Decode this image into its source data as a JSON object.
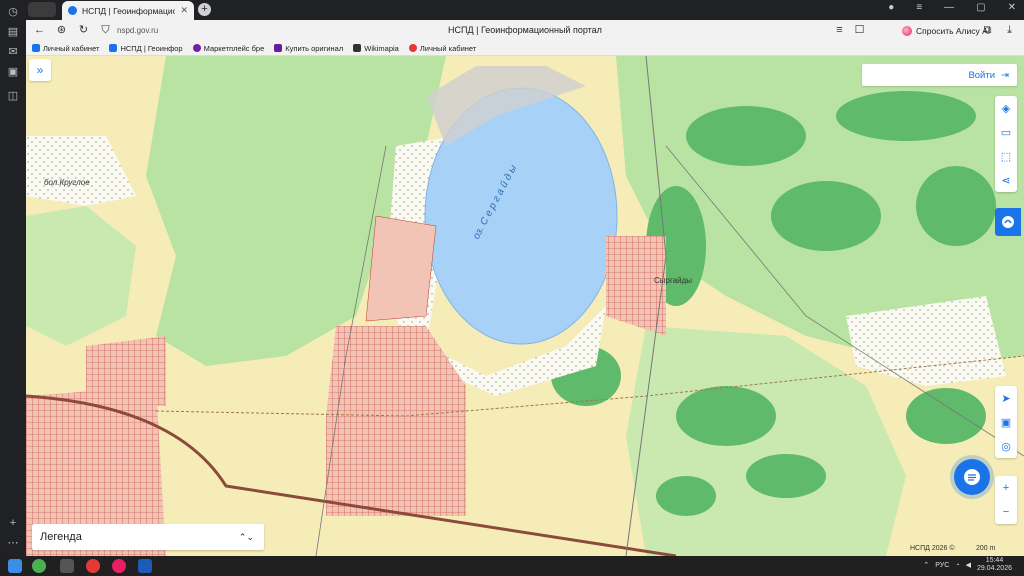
{
  "browser": {
    "tab_title": "НСПД | Геоинформационн",
    "url": "nspd.gov.ru",
    "page_title": "НСПД | Геоинформационный портал",
    "ask_button": "Спросить Алису AI"
  },
  "bookmarks": [
    {
      "label": "Личный кабинет",
      "color": "#1a73e8"
    },
    {
      "label": "НСПД | Геоинфор",
      "color": "#1a73e8"
    },
    {
      "label": "Маркетплейс бре",
      "color": "#7b1fa2"
    },
    {
      "label": "Купить оригинал",
      "color": "#6a1b9a"
    },
    {
      "label": "Wikimapia",
      "color": "#333333"
    },
    {
      "label": "Личный кабинет",
      "color": "#e53935"
    }
  ],
  "map": {
    "login_label": "Войти",
    "legend_label": "Легенда",
    "copyright": "НСПД 2026 ©",
    "scale": "200 m",
    "labels": {
      "place1": "бол.Круглое",
      "place2": "Сыргайды",
      "lake": "оз. С е р г а й д ы"
    },
    "colors": {
      "field": "#f5ecb8",
      "forest": "#b9e3a2",
      "dense_forest": "#5fba6b",
      "water": "#a8d1f7",
      "settlement": "#f1c4b6",
      "parcels": "#c0392b"
    }
  },
  "taskbar": {
    "lang": "РУС",
    "time": "15:44",
    "date": "29.04.2026"
  }
}
